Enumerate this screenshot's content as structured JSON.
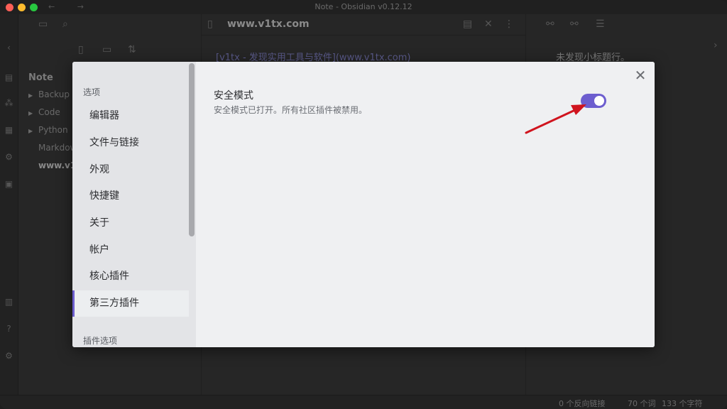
{
  "window": {
    "title": "Note - Obsidian v0.12.12",
    "nav_arrows": "← →"
  },
  "ribbon": {
    "icons": [
      "file-icon",
      "graph-icon",
      "calendar-icon",
      "plugin-icon",
      "daily-note-icon",
      "vault-icon",
      "help-icon",
      "settings-icon"
    ]
  },
  "file_explorer": {
    "vault_name": "Note",
    "items": [
      {
        "label": "Backup",
        "type": "folder"
      },
      {
        "label": "Code",
        "type": "folder"
      },
      {
        "label": "Python",
        "type": "folder"
      },
      {
        "label": "Markdow",
        "type": "file"
      },
      {
        "label": "www.v1t",
        "type": "file-active"
      }
    ]
  },
  "editor": {
    "title": "www.v1tx.com",
    "line1": "[v1tx - 发现实用工具与软件](www.v1tx.com)"
  },
  "outline": {
    "message": "未发现小标题行。"
  },
  "statusbar": {
    "backlinks": "0 个反向链接",
    "words": "70 个词",
    "chars": "133 个字符"
  },
  "settings": {
    "section_options": "选项",
    "section_plugin_options": "插件选项",
    "nav": [
      {
        "label": "编辑器"
      },
      {
        "label": "文件与链接"
      },
      {
        "label": "外观"
      },
      {
        "label": "快捷键"
      },
      {
        "label": "关于"
      },
      {
        "label": "帐户"
      },
      {
        "label": "核心插件"
      },
      {
        "label": "第三方插件"
      }
    ],
    "close_glyph": "✕",
    "safe_mode": {
      "name": "安全模式",
      "description": "安全模式已打开。所有社区插件被禁用。",
      "enabled": true
    }
  },
  "colors": {
    "accent": "#6d5ecf",
    "annotation_arrow": "#d0141e"
  }
}
